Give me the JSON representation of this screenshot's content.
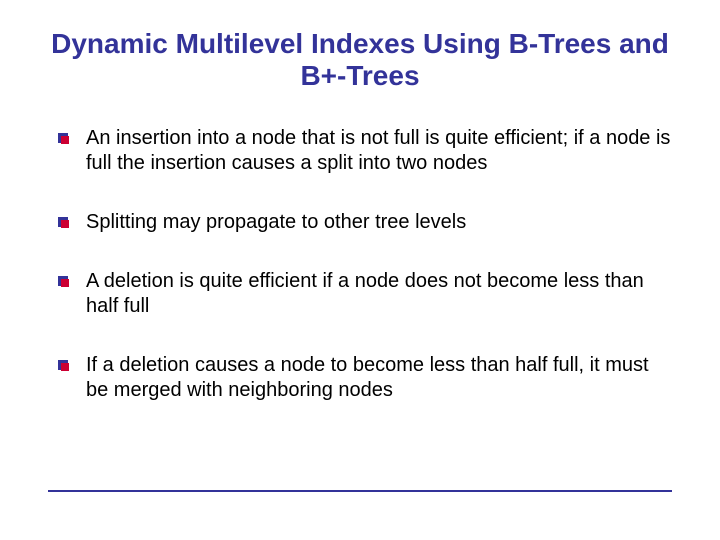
{
  "title": "Dynamic Multilevel Indexes Using B-Trees and B+-Trees",
  "bullets": [
    "An insertion into a node that is not full is quite efficient; if a node is full the insertion causes a split into two nodes",
    "Splitting may propagate to other tree levels",
    "A deletion is quite efficient if a node does not become less than half full",
    "If a deletion causes a node to become less than half full, it must be merged with neighboring nodes"
  ]
}
